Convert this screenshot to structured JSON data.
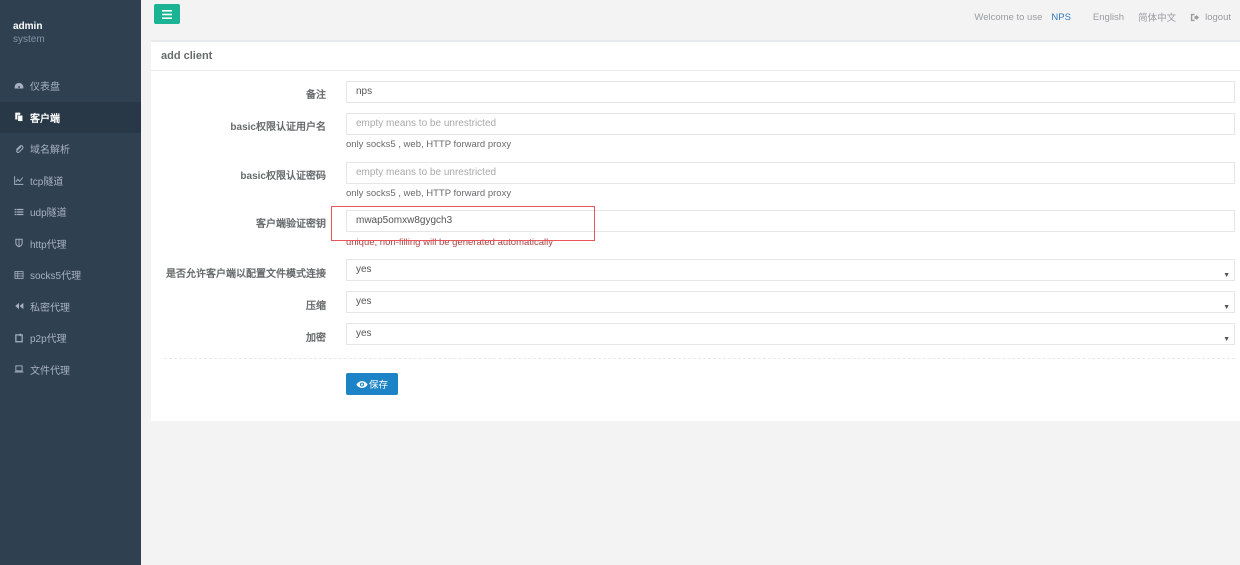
{
  "sidebar": {
    "user": "admin",
    "role": "system",
    "items": [
      {
        "label": "仪表盘",
        "icon": "dashboard-icon"
      },
      {
        "label": "客户端",
        "icon": "clients-icon",
        "active": true
      },
      {
        "label": "域名解析",
        "icon": "paperclip-icon"
      },
      {
        "label": "tcp隧道",
        "icon": "line-chart-icon"
      },
      {
        "label": "udp隧道",
        "icon": "list-icon"
      },
      {
        "label": "http代理",
        "icon": "shield-icon"
      },
      {
        "label": "socks5代理",
        "icon": "table-icon"
      },
      {
        "label": "私密代理",
        "icon": "backward-icon"
      },
      {
        "label": "p2p代理",
        "icon": "tablet-icon"
      },
      {
        "label": "文件代理",
        "icon": "laptop-icon"
      }
    ]
  },
  "topbar": {
    "welcome": "Welcome to use",
    "brand": "NPS",
    "lang_en": "English",
    "lang_zh": "简体中文",
    "logout": "logout"
  },
  "panel": {
    "title": "add client",
    "fields": {
      "remark": {
        "label": "备注",
        "value": "nps"
      },
      "basic_user": {
        "label": "basic权限认证用户名",
        "placeholder": "empty means to be unrestricted",
        "help": "only socks5 , web, HTTP forward proxy"
      },
      "basic_pass": {
        "label": "basic权限认证密码",
        "placeholder": "empty means to be unrestricted",
        "help": "only socks5 , web, HTTP forward proxy"
      },
      "vkey": {
        "label": "客户端验证密钥",
        "value": "mwap5omxw8gygch3",
        "help": "unique, non-filling will be generated automatically"
      },
      "config_conn": {
        "label": "是否允许客户端以配置文件模式连接",
        "value": "yes"
      },
      "compress": {
        "label": "压缩",
        "value": "yes"
      },
      "crypt": {
        "label": "加密",
        "value": "yes"
      }
    },
    "save_label": "保存"
  },
  "colors": {
    "sidebar_bg": "#2f4050",
    "primary": "#1ab394",
    "save": "#1c84c6",
    "highlight": "#e8575a"
  }
}
